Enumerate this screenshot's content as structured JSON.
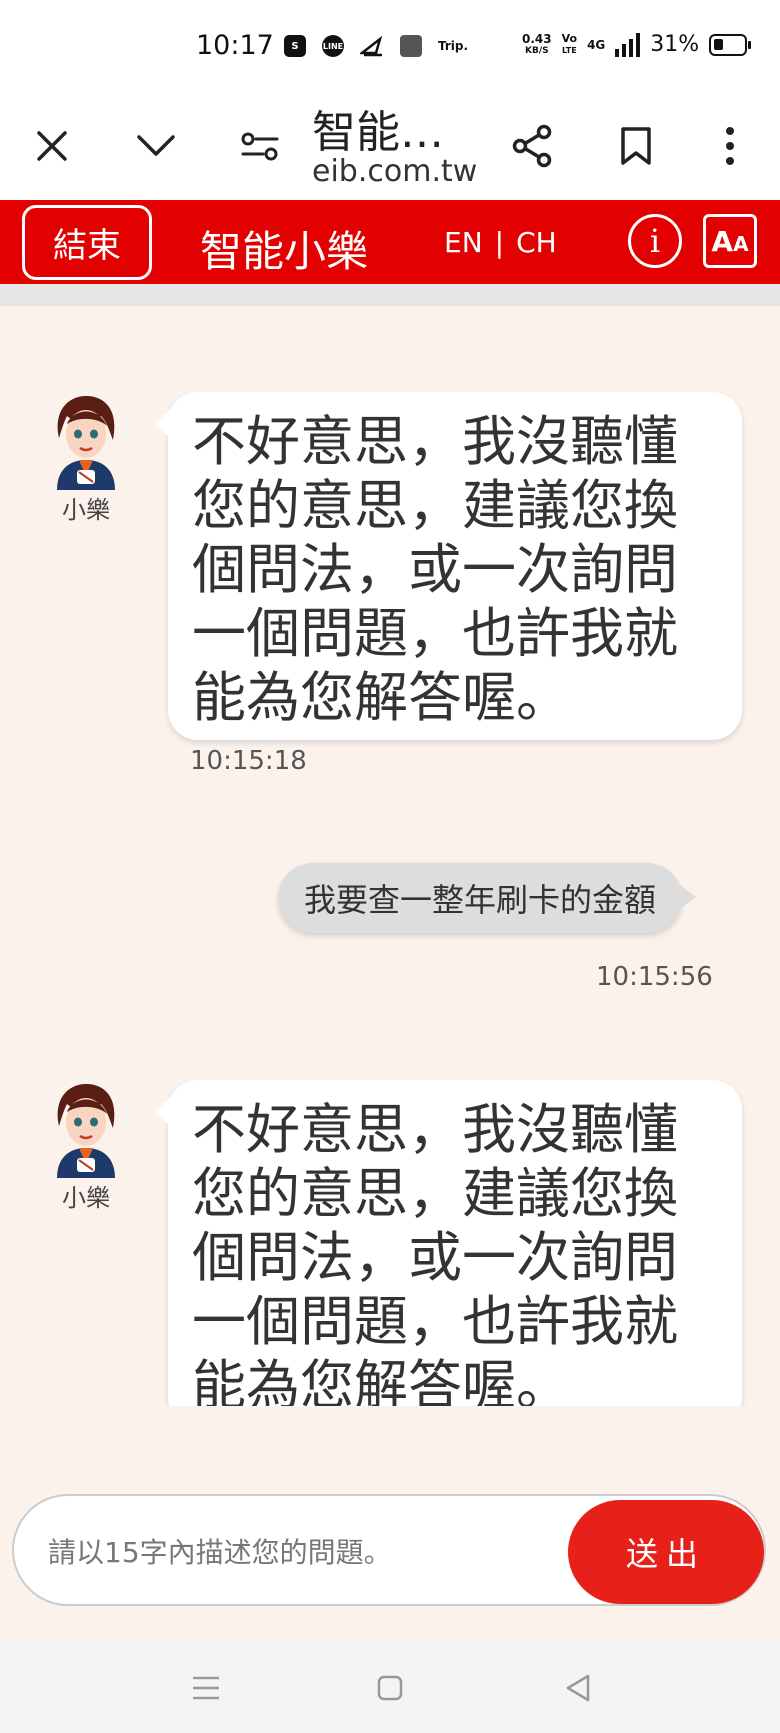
{
  "status_bar": {
    "time": "10:17",
    "app_icons": [
      "S",
      "LINE",
      "",
      "",
      "Trip."
    ],
    "net_speed_value": "0.43",
    "net_speed_unit": "KB/S",
    "volte_top": "Vo",
    "volte_bottom": "LTE",
    "network": "4G",
    "battery": "31%"
  },
  "browser": {
    "title": "智能…",
    "url": "eib.com.tw",
    "icons": [
      "close-icon",
      "chevron-down-icon",
      "site-settings-icon",
      "share-icon",
      "bookmark-icon",
      "more-vert-icon"
    ]
  },
  "chat_header": {
    "end_label": "結束",
    "title": "智能小樂",
    "lang_en": "EN",
    "lang_sep": "|",
    "lang_ch": "CH",
    "info_label": "i",
    "font_big": "A",
    "font_small": "A",
    "color": "#e30000"
  },
  "messages": [
    {
      "sender": "bot",
      "name": "小樂",
      "text": "不好意思，我沒聽懂您的意思，建議您換個問法，或一次詢問一個問題，也許我就能為您解答喔。",
      "time": "10:15:18"
    },
    {
      "sender": "user",
      "text": "我要查一整年刷卡的金額",
      "time": "10:15:56"
    },
    {
      "sender": "bot",
      "name": "小樂",
      "text": "不好意思，我沒聽懂您的意思，建議您換個問法，或一次詢問一個問題，也許我就能為您解答喔。"
    }
  ],
  "input": {
    "placeholder": "請以15字內描述您的問題。",
    "value": "",
    "send_label": "送出"
  },
  "nav_bar": {
    "icons": [
      "recents-icon",
      "home-icon",
      "back-icon"
    ]
  }
}
